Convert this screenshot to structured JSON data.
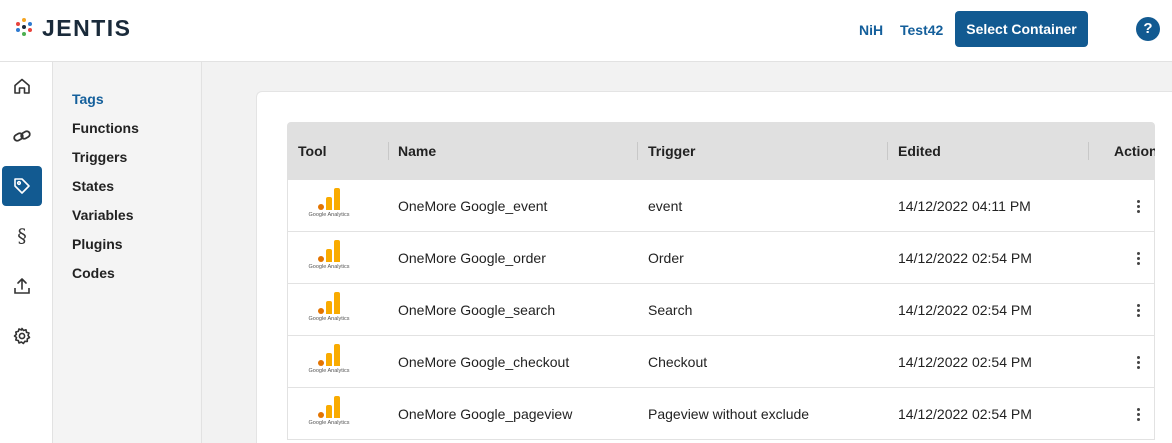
{
  "header": {
    "logo_text": "JENTIS",
    "user_label": "NiH",
    "container_label": "Test42",
    "select_button": "Select Container",
    "help_label": "?"
  },
  "rail": {
    "items": [
      {
        "icon": "home-icon"
      },
      {
        "icon": "link-icon"
      },
      {
        "icon": "tag-icon",
        "active": true
      },
      {
        "icon": "section-icon",
        "glyph": "§"
      },
      {
        "icon": "upload-icon"
      },
      {
        "icon": "gear-icon"
      }
    ]
  },
  "subnav": {
    "items": [
      {
        "label": "Tags",
        "active": true
      },
      {
        "label": "Functions"
      },
      {
        "label": "Triggers"
      },
      {
        "label": "States"
      },
      {
        "label": "Variables"
      },
      {
        "label": "Plugins"
      },
      {
        "label": "Codes"
      }
    ]
  },
  "table": {
    "columns": [
      "Tool",
      "Name",
      "Trigger",
      "Edited",
      "Action"
    ],
    "rows": [
      {
        "tool": "Google Analytics",
        "name": "OneMore Google_event",
        "trigger": "event",
        "edited": "14/12/2022 04:11 PM"
      },
      {
        "tool": "Google Analytics",
        "name": "OneMore Google_order",
        "trigger": "Order",
        "edited": "14/12/2022 02:54 PM"
      },
      {
        "tool": "Google Analytics",
        "name": "OneMore Google_search",
        "trigger": "Search",
        "edited": "14/12/2022 02:54 PM"
      },
      {
        "tool": "Google Analytics",
        "name": "OneMore Google_checkout",
        "trigger": "Checkout",
        "edited": "14/12/2022 02:54 PM"
      },
      {
        "tool": "Google Analytics",
        "name": "OneMore Google_pageview",
        "trigger": "Pageview without exclude",
        "edited": "14/12/2022 02:54 PM"
      }
    ]
  },
  "colors": {
    "accent": "#125a91",
    "link": "#145f9b",
    "ga_orange": "#f9ab00",
    "ga_dark_orange": "#e37400"
  }
}
